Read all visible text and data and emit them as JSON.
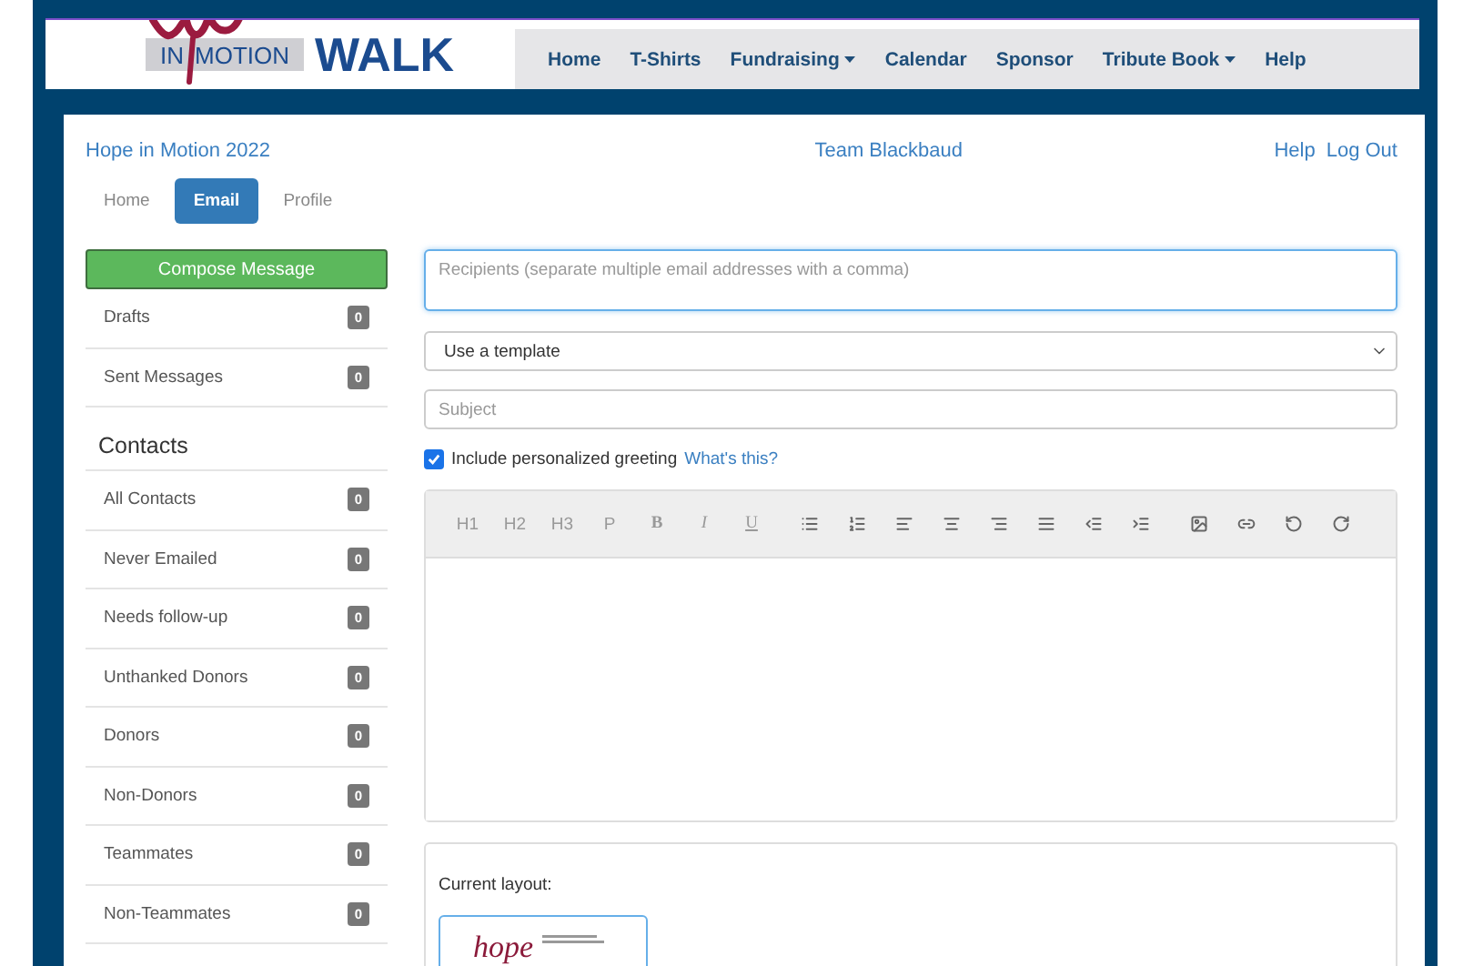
{
  "logo": {
    "line_1": "IN",
    "line_2": "MOTION",
    "line_3": "WALK"
  },
  "nav": [
    {
      "label": "Home",
      "dropdown": false
    },
    {
      "label": "T-Shirts",
      "dropdown": false
    },
    {
      "label": "Fundraising",
      "dropdown": true
    },
    {
      "label": "Calendar",
      "dropdown": false
    },
    {
      "label": "Sponsor",
      "dropdown": false
    },
    {
      "label": "Tribute Book",
      "dropdown": true
    },
    {
      "label": "Help",
      "dropdown": false
    }
  ],
  "header": {
    "event": "Hope in Motion 2022",
    "team": "Team Blackbaud",
    "links": [
      "Help",
      "Log Out"
    ]
  },
  "tabs": [
    {
      "label": "Home",
      "selected": false
    },
    {
      "label": "Email",
      "selected": true
    },
    {
      "label": "Profile",
      "selected": false
    }
  ],
  "sidebar": {
    "compose": "Compose Message",
    "folders": [
      {
        "label": "Drafts",
        "count": "0"
      },
      {
        "label": "Sent Messages",
        "count": "0"
      }
    ],
    "contacts_heading": "Contacts",
    "contacts": [
      {
        "label": "All Contacts",
        "count": "0"
      },
      {
        "label": "Never Emailed",
        "count": "0"
      },
      {
        "label": "Needs follow-up",
        "count": "0"
      },
      {
        "label": "Unthanked Donors",
        "count": "0"
      },
      {
        "label": "Donors",
        "count": "0"
      },
      {
        "label": "Non-Donors",
        "count": "0"
      },
      {
        "label": "Teammates",
        "count": "0"
      },
      {
        "label": "Non-Teammates",
        "count": "0"
      }
    ]
  },
  "compose": {
    "recipients": {
      "placeholder": "Recipients (separate multiple email addresses with a comma)"
    },
    "template": {
      "value": "Use a template"
    },
    "subject": {
      "placeholder": "Subject"
    },
    "greeting": {
      "label": "Include personalized greeting",
      "checked": true,
      "link": "What's this?"
    },
    "toolbar_text_buttons": [
      "H1",
      "H2",
      "H3",
      "P",
      "B",
      "I",
      "U"
    ],
    "layout": {
      "label": "Current layout:",
      "thumbnail_text": "hope"
    }
  }
}
